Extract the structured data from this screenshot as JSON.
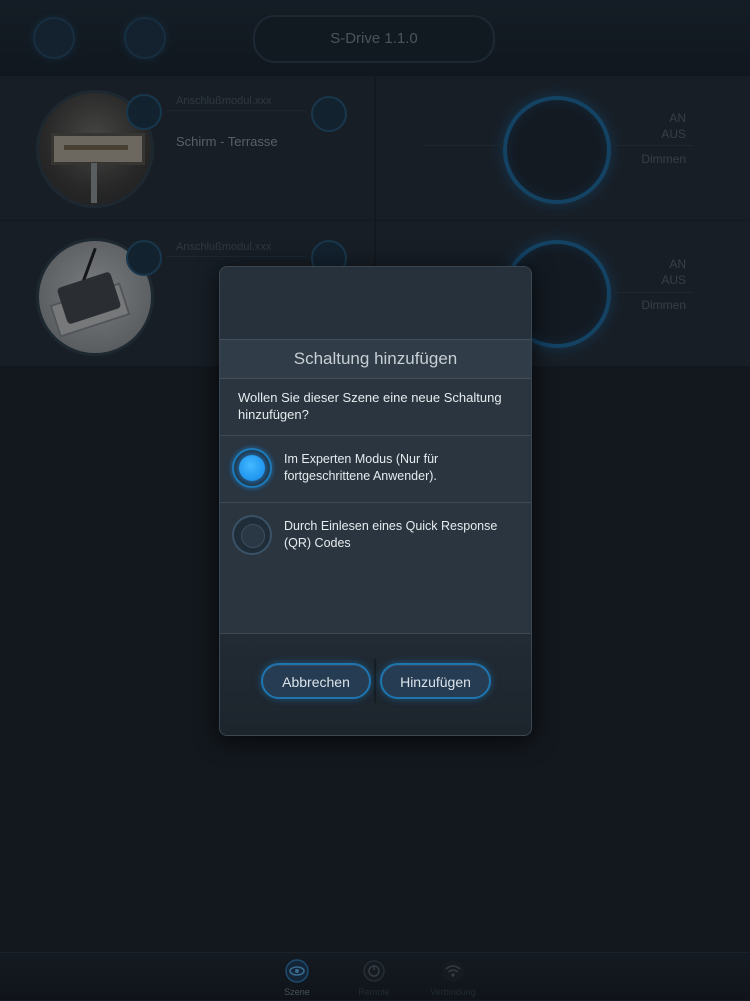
{
  "app": {
    "title": "S-Drive 1.1.0",
    "rows": [
      {
        "module_label": "Anschlußmodul.xxx",
        "name": "Schirm - Terrasse",
        "on": "AN",
        "off": "AUS",
        "dim": "Dimmen"
      },
      {
        "module_label": "Anschlußmodul.xxx",
        "name": "",
        "on": "AN",
        "off": "AUS",
        "dim": "Dimmen"
      }
    ]
  },
  "dialog": {
    "title": "Schaltung hinzufügen",
    "question": "Wollen Sie dieser Szene eine neue Schaltung hinzufügen?",
    "options": [
      {
        "label": "Im Experten Modus (Nur für fortgeschrittene Anwender).",
        "selected": true
      },
      {
        "label": "Durch Einlesen eines Quick Response (QR) Codes",
        "selected": false
      }
    ],
    "cancel_label": "Abbrechen",
    "add_label": "Hinzufügen"
  },
  "tabbar": {
    "tabs": [
      {
        "label": "Szene",
        "icon": "eye-icon",
        "active": true
      },
      {
        "label": "Remote",
        "icon": "remote-icon",
        "active": false
      },
      {
        "label": "Verbindung",
        "icon": "wifi-icon",
        "active": false
      }
    ]
  },
  "colors": {
    "accent": "#1a8fe8",
    "background": "#1a2129",
    "dialog": "#2a3540"
  }
}
